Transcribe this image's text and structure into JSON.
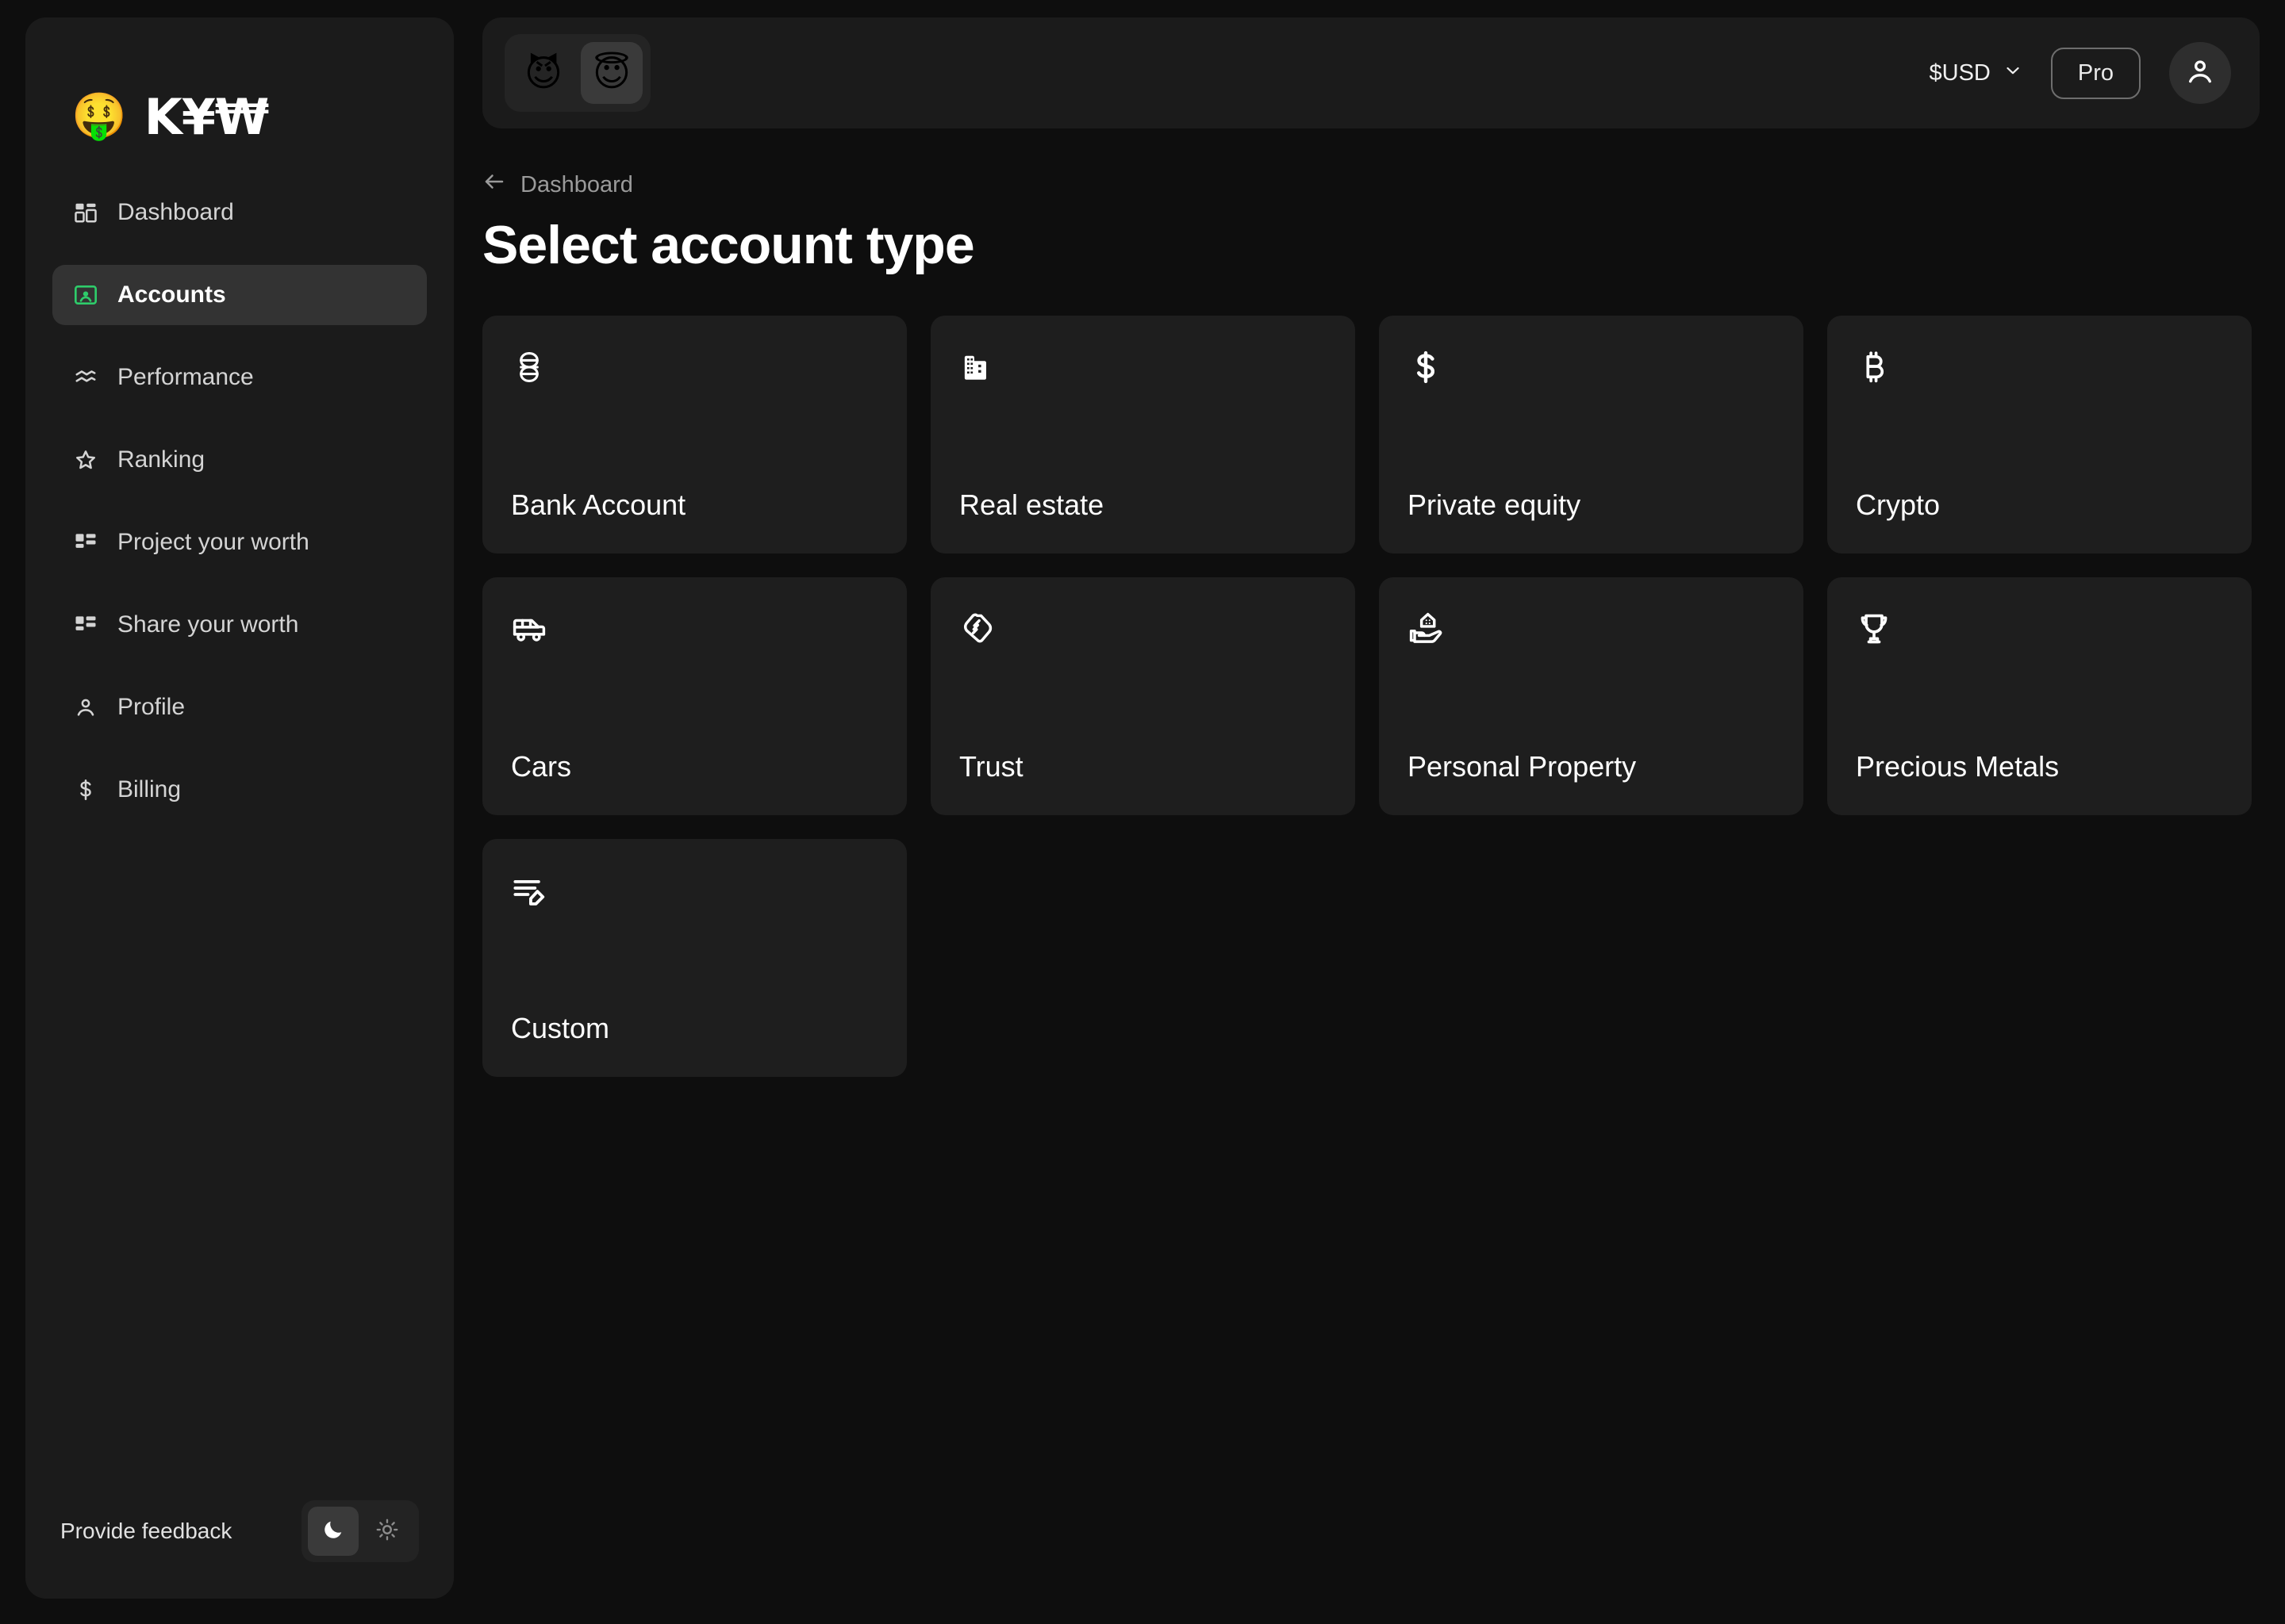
{
  "brand": {
    "emoji": "🤑",
    "emoji_name": "money-mouth-face",
    "name": "K¥₩"
  },
  "sidebar": {
    "items": [
      {
        "label": "Dashboard",
        "icon": "dashboard-grid-icon",
        "active": false
      },
      {
        "label": "Accounts",
        "icon": "contact-card-icon",
        "active": true
      },
      {
        "label": "Performance",
        "icon": "waves-icon",
        "active": false
      },
      {
        "label": "Ranking",
        "icon": "star-icon",
        "active": false
      },
      {
        "label": "Project your worth",
        "icon": "layout-blocks-icon",
        "active": false
      },
      {
        "label": "Share your worth",
        "icon": "layout-blocks-icon",
        "active": false
      },
      {
        "label": "Profile",
        "icon": "person-icon",
        "active": false
      },
      {
        "label": "Billing",
        "icon": "dollar-icon",
        "active": false
      }
    ],
    "footer": {
      "feedback_label": "Provide feedback",
      "theme": {
        "dark_icon": "moon-icon",
        "light_icon": "sun-icon",
        "selected": "dark"
      }
    },
    "accent_color": "#2ecc6a"
  },
  "topbar": {
    "mood_toggle": {
      "options": [
        {
          "emoji": "😈",
          "name": "devil-face-emoji",
          "selected": false
        },
        {
          "emoji": "😇",
          "name": "angel-face-emoji",
          "selected": true
        }
      ]
    },
    "currency": {
      "value": "$USD",
      "chevron": "chevron-down-icon"
    },
    "pro_label": "Pro",
    "avatar_icon": "person-icon"
  },
  "page": {
    "back_icon": "arrow-left-icon",
    "breadcrumb": "Dashboard",
    "title": "Select account type"
  },
  "account_types": [
    {
      "label": "Bank Account",
      "icon": "woven-knot-icon"
    },
    {
      "label": "Real estate",
      "icon": "building-icon"
    },
    {
      "label": "Private equity",
      "icon": "dollar-sign-icon"
    },
    {
      "label": "Crypto",
      "icon": "bitcoin-icon"
    },
    {
      "label": "Cars",
      "icon": "van-icon"
    },
    {
      "label": "Trust",
      "icon": "handshake-icon"
    },
    {
      "label": "Personal Property",
      "icon": "hand-holding-house-icon"
    },
    {
      "label": "Precious Metals",
      "icon": "trophy-icon"
    },
    {
      "label": "Custom",
      "icon": "edit-list-icon"
    }
  ],
  "colors": {
    "page_background": "#0e0e0e",
    "panel_background": "#1b1b1b",
    "card_background": "#1e1e1e",
    "active_item_background": "#333333",
    "accent_green": "#2ecc6a",
    "text_primary": "#ffffff",
    "text_muted": "#9a9a9a"
  }
}
